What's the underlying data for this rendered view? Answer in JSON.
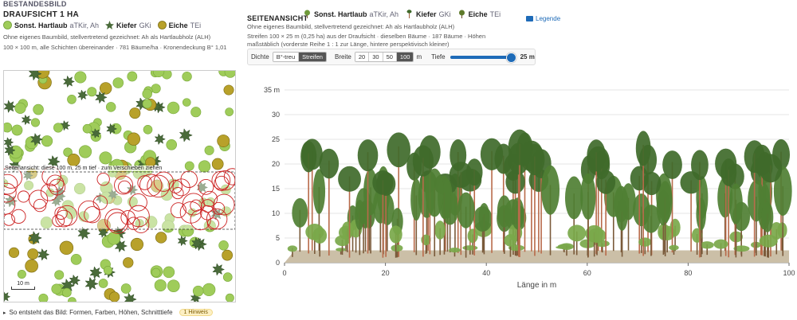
{
  "header": {
    "section_label": "BESTANDESBILD",
    "title": "DRAUFSICHT 1 HA"
  },
  "top_view": {
    "legend": [
      {
        "name": "Sonst. Hartlaub",
        "abbr": "aTKir, Ah",
        "icon": "hardwood-icon"
      },
      {
        "name": "Kiefer",
        "abbr": "GKi",
        "icon": "pine-icon"
      },
      {
        "name": "Eiche",
        "abbr": "TEi",
        "icon": "oak-icon"
      }
    ],
    "note": "Ohne eigenes Baumbild, stellvertretend gezeichnet: Ah als Hartlaubholz (ALH)",
    "info": "100 × 100 m, alle Schichten übereinander · 781 Bäume/ha · Kronendeckung B° 1,01",
    "overlay_label": "Seitenansicht: diese 100 m, 25 m tief · zum Verschieben ziehen",
    "scale_label": "10 m"
  },
  "side_view": {
    "title": "SEITENANSICHT",
    "legend": [
      {
        "name": "Sonst. Hartlaub",
        "abbr": "aTKir, Ah",
        "icon": "hardwood-sapling-icon"
      },
      {
        "name": "Kiefer",
        "abbr": "GKi",
        "icon": "pine-tree-icon"
      },
      {
        "name": "Eiche",
        "abbr": "TEi",
        "icon": "oak-tree-icon"
      }
    ],
    "legend_link": "Legende",
    "note": "Ohne eigenes Baumbild, stellvertretend gezeichnet: Ah als Hartlaubholz (ALH)",
    "desc_line1": "Streifen 100 × 25 m (0,25 ha) aus der Draufsicht · dieselben Bäume · 187 Bäume · Höhen",
    "desc_line2": "maßstäblich (vorderste Reihe 1 : 1 zur Länge, hintere perspektivisch kleiner)",
    "controls": {
      "dichte_label": "Dichte",
      "dichte_options": [
        "B°-treu",
        "Streifen"
      ],
      "breite_label": "Breite",
      "breite_options": [
        "20",
        "30",
        "50",
        "100"
      ],
      "breite_unit": "m",
      "tiefe_label": "Tiefe",
      "tiefe_value": "25 m",
      "tiefe_fraction": 0.96
    }
  },
  "chart_data": {
    "type": "scatter",
    "x_label": "Länge in m",
    "y_unit": "m",
    "xlim": [
      0,
      100
    ],
    "ylim": [
      0,
      35
    ],
    "x_ticks": [
      0,
      20,
      40,
      60,
      80,
      100
    ],
    "y_ticks": [
      0,
      5,
      10,
      15,
      20,
      25,
      30,
      35
    ],
    "grid": true
  },
  "footer": {
    "text": "So entsteht das Bild: Formen, Farben, Höhen, Schnitttiefe",
    "badge": "1 Hinweis"
  },
  "colors": {
    "hardwood": "#9fcc5a",
    "pine": "#4a6b3a",
    "oak": "#b8a12a",
    "overlay": "#cc2222",
    "link": "#1e6bb8"
  }
}
